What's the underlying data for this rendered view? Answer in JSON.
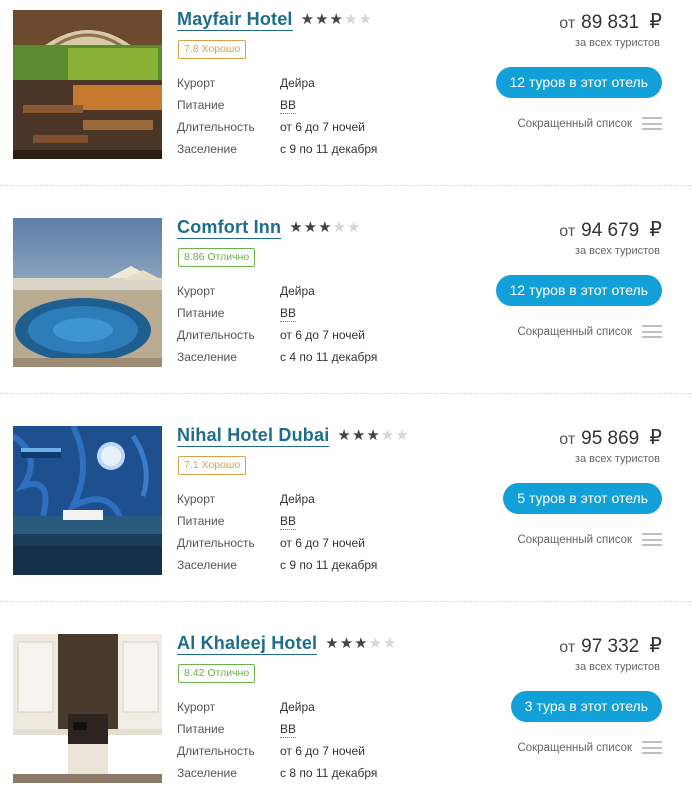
{
  "labels": {
    "resort": "Курорт",
    "meal": "Питание",
    "duration": "Длительность",
    "checkin": "Заселение",
    "price_prefix": "от",
    "currency": "₽",
    "price_note": "за всех туристов",
    "shortlist": "Сокращенный список"
  },
  "colors": {
    "brand_link": "#1f6d8c",
    "button_bg": "#12a0d8",
    "rating_good": "#d8a14a",
    "rating_excellent": "#6ab04c"
  },
  "hotels": [
    {
      "name": "Mayfair Hotel",
      "stars": 3,
      "stars_total": 5,
      "rating": "7.8 Хорошо",
      "rating_color": "#d8a14a",
      "resort": "Дейра",
      "meal": "BB",
      "duration": "от 6 до 7 ночей",
      "checkin": "с 9 по 11 декабря",
      "price": "89 831",
      "tours": "12 туров в этот отель",
      "photo": "restaurant-photo"
    },
    {
      "name": "Comfort Inn",
      "stars": 3,
      "stars_total": 5,
      "rating": "8.86 Отлично",
      "rating_color": "#6ab04c",
      "resort": "Дейра",
      "meal": "BB",
      "duration": "от 6 до 7 ночей",
      "checkin": "с 4 по 11 декабря",
      "price": "94 679",
      "tours": "12 туров в этот отель",
      "photo": "rooftop-pool-photo"
    },
    {
      "name": "Nihal Hotel Dubai",
      "stars": 3,
      "stars_total": 5,
      "rating": "7.1 Хорошо",
      "rating_color": "#d8a14a",
      "resort": "Дейра",
      "meal": "BB",
      "duration": "от 6 до 7 ночей",
      "checkin": "с 9 по 11 декабря",
      "price": "95 869",
      "tours": "5 туров в этот отель",
      "photo": "blue-room-photo"
    },
    {
      "name": "Al Khaleej Hotel",
      "stars": 3,
      "stars_total": 5,
      "rating": "8.42 Отлично",
      "rating_color": "#6ab04c",
      "resort": "Дейра",
      "meal": "BB",
      "duration": "от 6 до 7 ночей",
      "checkin": "с 8 по 11 декабря",
      "price": "97 332",
      "tours": "3 тура в этот отель",
      "photo": "bedroom-photo"
    }
  ]
}
